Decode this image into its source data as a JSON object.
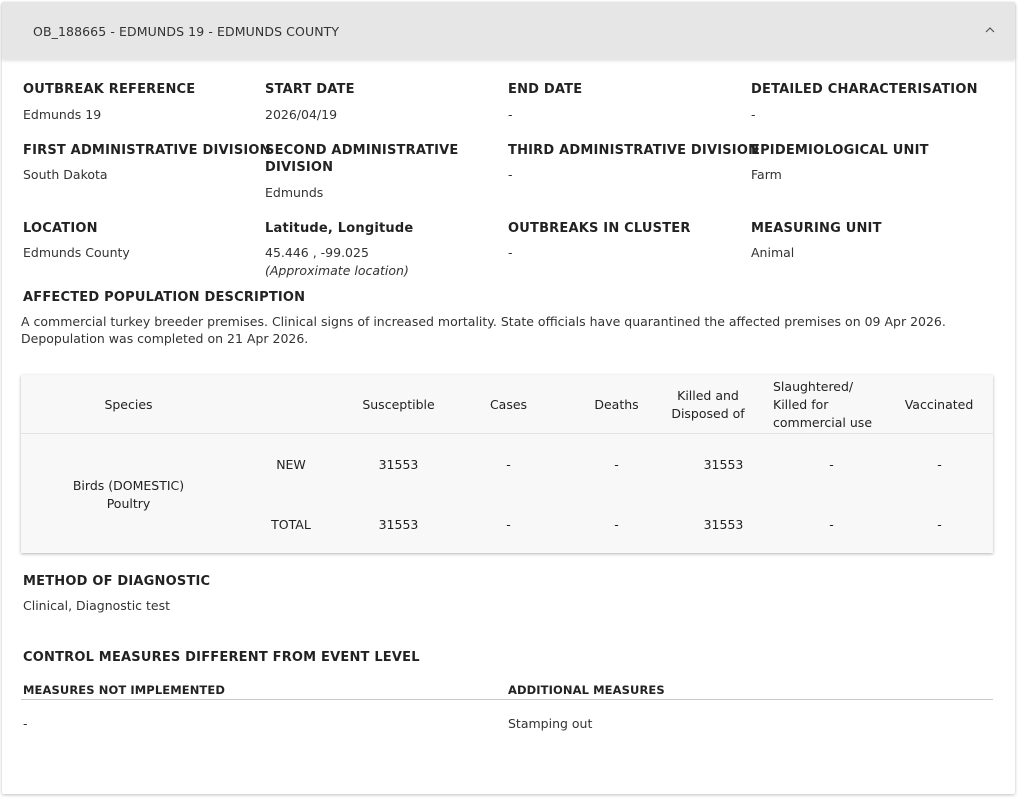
{
  "header": {
    "title": "OB_188665 - EDMUNDS 19 - EDMUNDS COUNTY"
  },
  "fields": {
    "outbreak_reference": {
      "label": "OUTBREAK REFERENCE",
      "value": "Edmunds 19"
    },
    "start_date": {
      "label": "START DATE",
      "value": "2026/04/19"
    },
    "end_date": {
      "label": "END DATE",
      "value": "-"
    },
    "detailed_characterisation": {
      "label": "DETAILED CHARACTERISATION",
      "value": "-"
    },
    "first_admin_division": {
      "label": "FIRST ADMINISTRATIVE DIVISION",
      "value": "South Dakota"
    },
    "second_admin_division": {
      "label_line1": "SECOND ADMINISTRATIVE",
      "label_line2": "DIVISION",
      "value": "Edmunds"
    },
    "third_admin_division": {
      "label": "THIRD ADMINISTRATIVE DIVISION",
      "value": "-"
    },
    "epidemiological_unit": {
      "label": "EPIDEMIOLOGICAL UNIT",
      "value": "Farm"
    },
    "location": {
      "label": "LOCATION",
      "value": "Edmunds County"
    },
    "lat_long": {
      "label": "Latitude, Longitude",
      "value": "45.446 , -99.025",
      "note": "(Approximate location)"
    },
    "outbreaks_in_cluster": {
      "label": "OUTBREAKS IN CLUSTER",
      "value": "-"
    },
    "measuring_unit": {
      "label": "MEASURING UNIT",
      "value": "Animal"
    }
  },
  "affected_population": {
    "label": "AFFECTED POPULATION DESCRIPTION",
    "line1": "A commercial turkey breeder premises. Clinical signs of increased mortality. State officials have quarantined the affected premises on 09 Apr 2026.",
    "line2": "Depopulation was completed on 21 Apr 2026."
  },
  "species_table": {
    "headers": {
      "species": "Species",
      "susceptible": "Susceptible",
      "cases": "Cases",
      "deaths": "Deaths",
      "killed_line1": "Killed and",
      "killed_line2": "Disposed of",
      "slaughtered_line1": "Slaughtered/",
      "slaughtered_line2": "Killed for",
      "slaughtered_line3": "commercial use",
      "vaccinated": "Vaccinated"
    },
    "species_name_line1": "Birds (DOMESTIC)",
    "species_name_line2": "Poultry",
    "rows": [
      {
        "label": "NEW",
        "susceptible": "31553",
        "cases": "-",
        "deaths": "-",
        "killed": "31553",
        "slaughtered": "-",
        "vaccinated": "-"
      },
      {
        "label": "TOTAL",
        "susceptible": "31553",
        "cases": "-",
        "deaths": "-",
        "killed": "31553",
        "slaughtered": "-",
        "vaccinated": "-"
      }
    ]
  },
  "method_of_diagnostic": {
    "label": "METHOD OF DIAGNOSTIC",
    "value": "Clinical, Diagnostic test"
  },
  "control_measures": {
    "title": "CONTROL MEASURES DIFFERENT FROM EVENT LEVEL",
    "not_implemented_label": "MEASURES NOT IMPLEMENTED",
    "not_implemented_value": "-",
    "additional_label": "ADDITIONAL MEASURES",
    "additional_value": "Stamping out"
  },
  "icons": {
    "collapse": "chevron-up-icon"
  }
}
